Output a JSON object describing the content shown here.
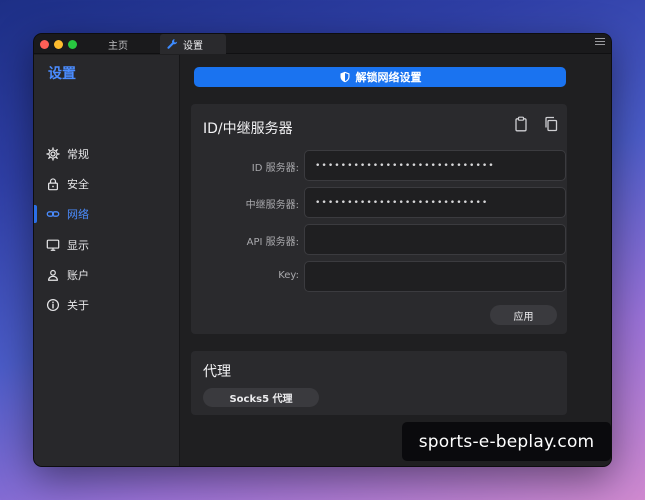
{
  "titlebar": {
    "tabs": [
      {
        "label": "主页",
        "icon": "home-icon"
      },
      {
        "label": "设置",
        "icon": "wrench-icon"
      }
    ],
    "menu_icon": "hamburger-icon"
  },
  "sidebar": {
    "title": "设置",
    "items": [
      {
        "label": "常规",
        "icon": "gear-icon",
        "active": false
      },
      {
        "label": "安全",
        "icon": "lock-icon",
        "active": false
      },
      {
        "label": "网络",
        "icon": "link-icon",
        "active": true
      },
      {
        "label": "显示",
        "icon": "monitor-icon",
        "active": false
      },
      {
        "label": "账户",
        "icon": "user-icon",
        "active": false
      },
      {
        "label": "关于",
        "icon": "info-icon",
        "active": false
      }
    ]
  },
  "main": {
    "unlock_button": "解锁网络设置",
    "id_server_card": {
      "title": "ID/中继服务器",
      "fields": [
        {
          "label": "ID 服务器:",
          "value": "••••••••••••••••••••••••••••"
        },
        {
          "label": "中继服务器:",
          "value": "•••••••••••••••••••••••••••"
        },
        {
          "label": "API 服务器:",
          "value": ""
        },
        {
          "label": "Key:",
          "value": ""
        }
      ],
      "apply_button": "应用"
    },
    "proxy_card": {
      "title": "代理",
      "socks5_button": "Socks5 代理"
    }
  },
  "watermark": "sports-e-beplay.com",
  "colors": {
    "accent": "#1a73f0",
    "sidebar_active": "#4a8cff",
    "window_bg": "#1f1f21",
    "card_bg": "#2a2a2d"
  }
}
